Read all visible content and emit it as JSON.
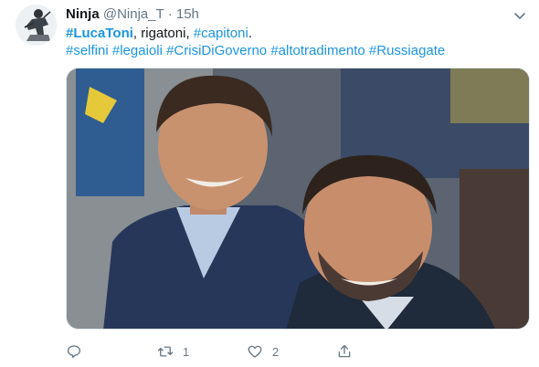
{
  "tweet": {
    "name": "Ninja",
    "handle": "@Ninja_T",
    "separator": "·",
    "time": "15h",
    "line1": {
      "tag1": "#LucaToni",
      "text1": ", rigatoni, ",
      "tag2": "#capitoni",
      "text2": "."
    },
    "line2": {
      "tags": [
        "#selfini",
        "#legaioli",
        "#CrisiDiGoverno",
        "#altotradimento",
        "#Russiagate"
      ]
    },
    "media": {
      "description": "selfie-photo"
    },
    "actions": {
      "reply": {
        "icon": "reply-icon",
        "count": ""
      },
      "retweet": {
        "icon": "retweet-icon",
        "count": "1"
      },
      "like": {
        "icon": "heart-icon",
        "count": "2"
      },
      "share": {
        "icon": "share-icon",
        "count": ""
      }
    }
  },
  "colors": {
    "link": "#1b95e0",
    "muted": "#657786",
    "text": "#14171a"
  }
}
